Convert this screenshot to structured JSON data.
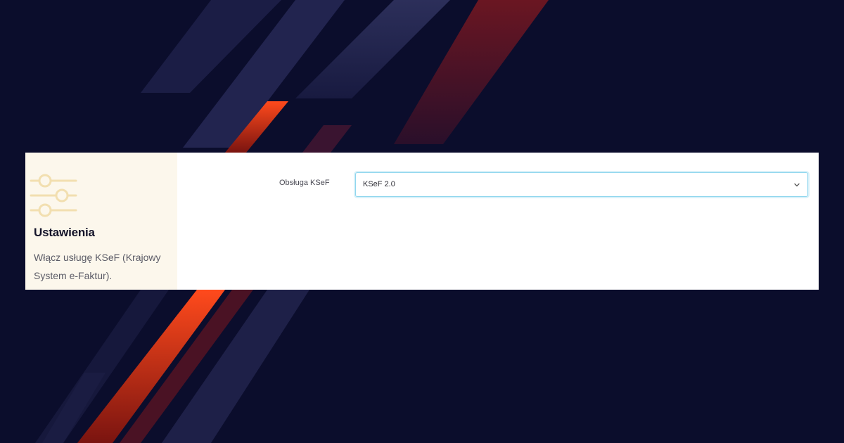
{
  "sidebar": {
    "icon": "sliders-icon",
    "title": "Ustawienia",
    "description": "Włącz usługę KSeF (Krajowy System e-Faktur)."
  },
  "form": {
    "field_label": "Obsługa KSeF",
    "select_value": "KSeF 2.0",
    "select_icon": "chevron-down-icon"
  },
  "colors": {
    "background": "#0b0d2c",
    "accent_red": "#e0361a",
    "sidebar_bg": "#fcf7ec",
    "icon_color": "#f2dfb0",
    "focus_border": "#8fd6ee"
  }
}
